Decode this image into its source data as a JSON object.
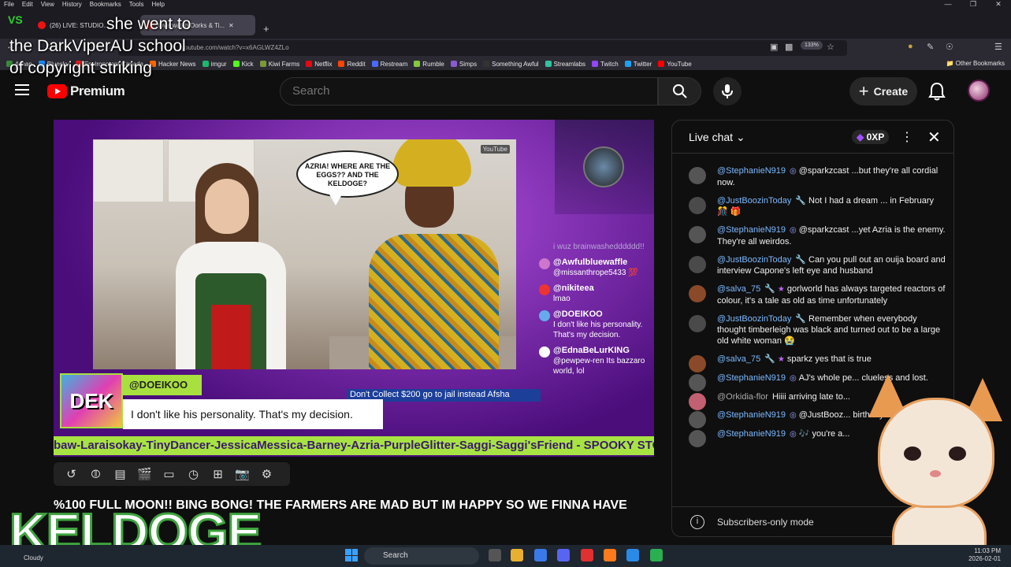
{
  "browser": {
    "menu": [
      "File",
      "Edit",
      "View",
      "History",
      "Bookmarks",
      "Tools",
      "Help"
    ],
    "tabs": [
      {
        "label": "(26) LIVE: STUDIO...",
        "active": false
      },
      {
        "label": "Overwatch Dorks & Ti...",
        "active": true
      }
    ],
    "url": "youtube.com/watch?v=x6AGLWZ4ZLo",
    "zoom": "133%",
    "bookmarks": [
      "4chan",
      "Bluesky",
      "Environment Canada",
      "Hacker News",
      "imgur",
      "Kick",
      "Kiwi Farms",
      "Netflix",
      "Reddit",
      "Restream",
      "Rumble",
      "Simps",
      "Something Awful",
      "Streamlabs",
      "Twitch",
      "Twitter",
      "YouTube"
    ],
    "other_bookmarks": "Other Bookmarks"
  },
  "overlay": {
    "vs_logo": "VS",
    "line1": "she went to",
    "line2": "the DarkViperAU school",
    "line3": "of copyright striking",
    "keldoge": "KELDOGE"
  },
  "youtube": {
    "logo_text": "Premium",
    "search_placeholder": "Search",
    "create_label": "Create"
  },
  "video": {
    "speech_bubble": "AZRIA! WHERE ARE THE EGGS?? AND THE KELDOGE?",
    "watermark": "YouTube",
    "overlay_chat": [
      {
        "user": "",
        "text": "i wuz brainwashedddddd!!",
        "faded": true
      },
      {
        "user": "@Awfulbluewaffle",
        "text": "@missanthrope5433 💯",
        "faded": false
      },
      {
        "user": "@nikiteea",
        "text": "lmao",
        "faded": false
      },
      {
        "user": "@DOEIKOO",
        "text": "I don't like his personality. That's my decision.",
        "faded": false
      },
      {
        "user": "@EdnaBeLurKING",
        "text": "@pewpew-ren Its bazzaro world, lol",
        "faded": false
      }
    ],
    "highlight_box": "DEK",
    "highlight_user": "@DOEIKOO",
    "highlight_msg": "I don't like his personality. That's my decision.",
    "news_ticker": "Don't Collect $200 go to jail instead Afsha",
    "names_ticker": "baw-Laraisokay-TinyDancer-JessicaMessica-Barney-Azria-PurpleGlitter-Saggi-Saggi'sFriend - SPOOKY STO"
  },
  "player_tools": [
    "loop-icon",
    "live-icon",
    "stats-icon",
    "clip-icon",
    "theater-icon",
    "speed-icon",
    "add-icon",
    "screenshot-icon",
    "settings-icon"
  ],
  "video_title": "%100 FULL MOON!! BING BONG! THE FARMERS ARE MAD BUT IM HAPPY SO WE FINNA HAVE",
  "chat": {
    "title": "Live chat",
    "xp": "0XP",
    "messages": [
      {
        "author": "@StephanieN919",
        "text": "@sparkzcast ...but they're all cordial now.",
        "avatar_color": "#555555"
      },
      {
        "author": "@JustBoozinToday",
        "text": "Not I had a dream ... in February 🎊 🎁",
        "avatar_color": "#4a4a4a"
      },
      {
        "author": "@StephanieN919",
        "text": "@sparkzcast ...yet Azria is the enemy. They're all weirdos.",
        "avatar_color": "#555555"
      },
      {
        "author": "@JustBoozinToday",
        "text": "Can you pull out an ouija board and interview Capone's left eye and husband",
        "avatar_color": "#4a4a4a"
      },
      {
        "author": "@salva_75",
        "text": "gorlworld has always targeted reactors of colour, it's a tale as old as time unfortunately",
        "avatar_color": "#8a4a2a"
      },
      {
        "author": "@JustBoozinToday",
        "text": "Remember when everybody thought timberleigh was black and turned out to be a large old white woman 😭",
        "avatar_color": "#4a4a4a"
      },
      {
        "author": "@salva_75",
        "text": "sparkz yes that is true",
        "avatar_color": "#8a4a2a"
      },
      {
        "author": "@StephanieN919",
        "text": "AJ's whole pe... clueless and lost.",
        "avatar_color": "#555555"
      },
      {
        "author": "@Orkidia-flor",
        "text": "Hiiii arriving late to...",
        "avatar_color": "#c06070"
      },
      {
        "author": "@StephanieN919",
        "text": "@JustBooz... birthday Timber 🎂",
        "avatar_color": "#555555"
      },
      {
        "author": "@StephanieN919",
        "text": "🎶 you're a...",
        "avatar_color": "#555555"
      }
    ],
    "footer": "Subscribers-only mode"
  },
  "taskbar": {
    "weather": "Cloudy",
    "search": "Search",
    "time": "11:03 PM",
    "date": "2026-02-01"
  }
}
